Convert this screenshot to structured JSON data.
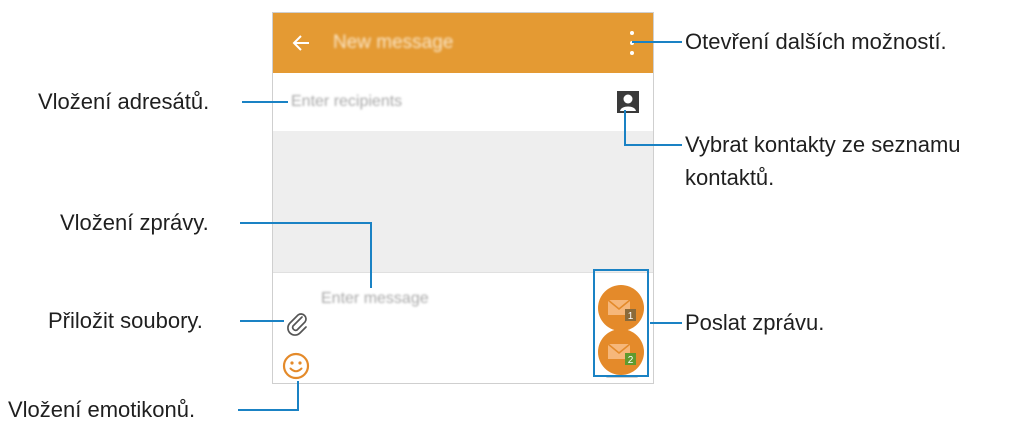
{
  "app": {
    "title": "New message",
    "recipients_placeholder": "Enter recipients",
    "message_placeholder": "Enter message",
    "send_sim1_badge": "1",
    "send_sim2_badge": "2"
  },
  "callouts": {
    "more_options": "Otevření dalších možností.",
    "recipients": "Vložení adresátů.",
    "contacts_line1": "Vybrat kontakty ze seznamu",
    "contacts_line2": "kontaktů.",
    "message": "Vložení zprávy.",
    "attach": "Přiložit soubory.",
    "send": "Poslat zprávu.",
    "emoticons": "Vložení emotikonů."
  },
  "colors": {
    "appbar": "#e49a33",
    "accent": "#e48a2a",
    "callout_line": "#1a82c4",
    "sim1_badge": "#8a6a3a",
    "sim2_badge": "#5f9a2e"
  },
  "icons": {
    "back": "back-arrow-icon",
    "more": "more-options-icon",
    "contacts": "contact-picker-icon",
    "attach": "paperclip-icon",
    "emoticon": "smiley-icon",
    "send": "envelope-icon"
  }
}
